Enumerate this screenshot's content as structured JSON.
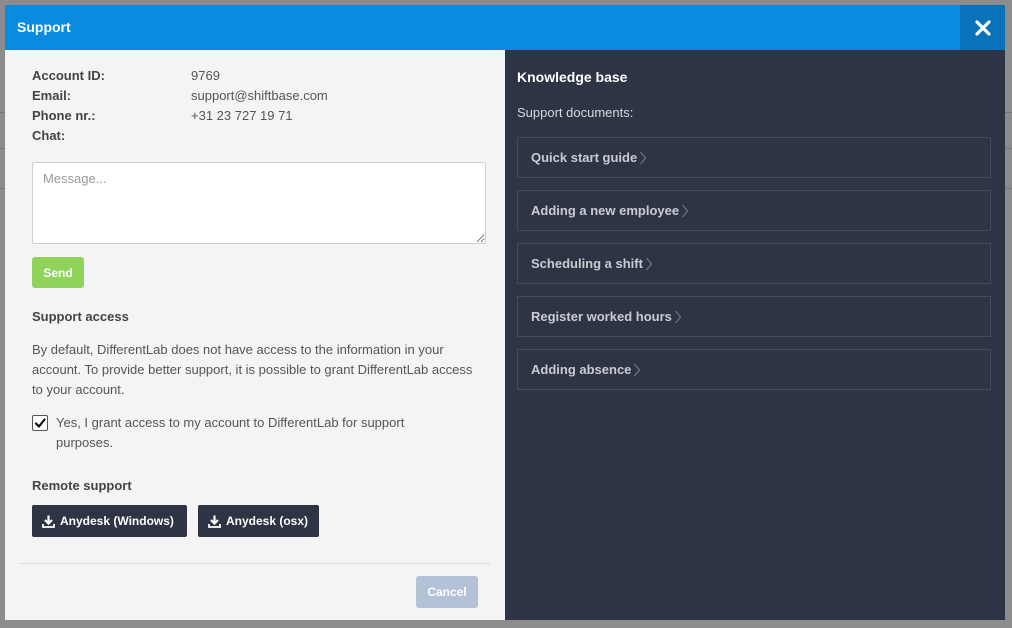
{
  "modal": {
    "title": "Support",
    "close_icon": "close-icon"
  },
  "contact": {
    "account_id": {
      "label": "Account ID:",
      "value": "9769"
    },
    "email": {
      "label": "Email:",
      "value": "support@shiftbase.com"
    },
    "phone": {
      "label": "Phone nr.:",
      "value": "+31 23 727 19 71"
    },
    "chat": {
      "label": "Chat:",
      "value": ""
    }
  },
  "message": {
    "placeholder": "Message...",
    "value": ""
  },
  "send_label": "Send",
  "support_access": {
    "title": "Support access",
    "description": "By default, DifferentLab does not have access to the information in your account. To provide better support, it is possible to grant DifferentLab access to your account.",
    "checkbox_label": "Yes, I grant access to my account to DifferentLab for support purposes.",
    "checked": true
  },
  "remote_support": {
    "title": "Remote support",
    "windows_label": "Anydesk (Windows)",
    "osx_label": "Anydesk (osx)"
  },
  "cancel_label": "Cancel",
  "knowledge_base": {
    "title": "Knowledge base",
    "subtitle": "Support documents:",
    "documents": [
      "Quick start guide",
      "Adding a new employee",
      "Scheduling a shift",
      "Register worked hours",
      "Adding absence"
    ]
  },
  "colors": {
    "header": "#0a8be0",
    "close_bg": "#0872bd",
    "send": "#8fd35a",
    "cancel": "#b3c2d6",
    "sidebar": "#2e3443",
    "download_button": "#2e3443"
  }
}
